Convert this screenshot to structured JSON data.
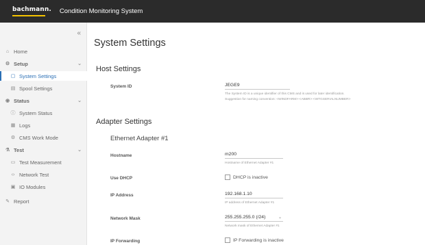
{
  "header": {
    "brand": "bachmann.",
    "title": "Condition Monitoring System"
  },
  "sidebar": {
    "collapse_glyph": "«",
    "items": [
      {
        "label": "Home",
        "icon": "home-icon"
      },
      {
        "label": "Setup",
        "icon": "gear-icon"
      },
      {
        "label": "System Settings",
        "icon": "square-icon"
      },
      {
        "label": "Spool Settings",
        "icon": "document-icon"
      },
      {
        "label": "Status",
        "icon": "eye-icon"
      },
      {
        "label": "System Status",
        "icon": "info-icon"
      },
      {
        "label": "Logs",
        "icon": "logs-icon"
      },
      {
        "label": "CMS Work Mode",
        "icon": "gear-icon"
      },
      {
        "label": "Test",
        "icon": "flask-icon"
      },
      {
        "label": "Test Measurement",
        "icon": "chart-icon"
      },
      {
        "label": "Network Test",
        "icon": "network-icon"
      },
      {
        "label": "IO Modules",
        "icon": "module-icon"
      },
      {
        "label": "Report",
        "icon": "report-icon"
      }
    ]
  },
  "main": {
    "title": "System Settings",
    "host_settings": {
      "heading": "Host Settings",
      "system_id_label": "System ID",
      "system_id_value": "JEGE9",
      "system_id_help_1": "The System ID is a unique identifier of this CMS and is used for later identification.",
      "system_id_help_2": "Suggestion for naming convention: <WINDFARM>-<ABBR>-<WTGSERIALNUMBER>"
    },
    "adapter_settings": {
      "heading": "Adapter Settings",
      "adapter_heading": "Ethernet Adapter #1",
      "hostname_label": "Hostname",
      "hostname_value": "m200",
      "hostname_help": "Hostname of Ethernet Adapter #1",
      "dhcp_label": "Use DHCP",
      "dhcp_text": "DHCP is inactive",
      "ip_label": "IP Address",
      "ip_value": "192.168.1.10",
      "ip_help": "IP address of Ethernet Adapter #1",
      "mask_label": "Network Mask",
      "mask_value": "255.255.255.0 (/24)",
      "mask_help": "Network mask of Ethernet Adapter #1",
      "forwarding_label": "IP Forwarding",
      "forwarding_text": "IP Forwarding is inactive"
    }
  },
  "colors": {
    "topbar": "#2b2b2b",
    "brand_accent": "#f5c400",
    "active": "#2a6fb5",
    "sidebar_bg": "#f3f3f3"
  }
}
